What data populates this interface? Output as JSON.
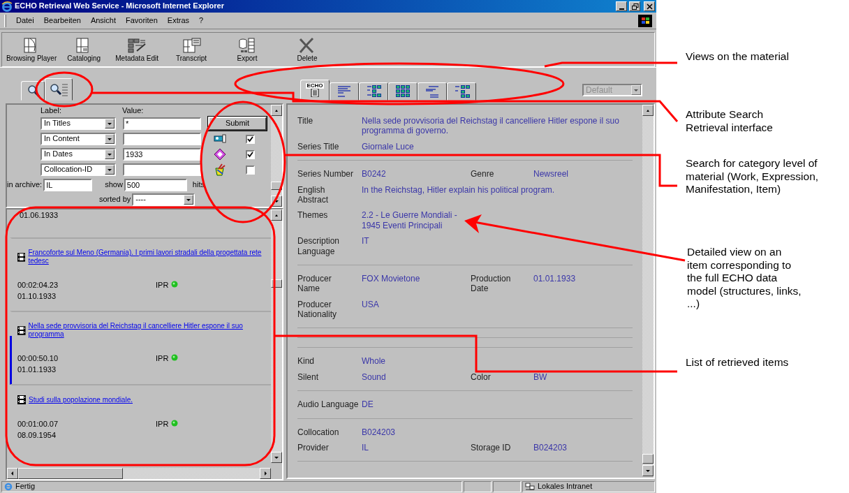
{
  "window": {
    "title": "ECHO Retrieval Web Service - Microsoft Internet Explorer"
  },
  "menu": [
    "Datei",
    "Bearbeiten",
    "Ansicht",
    "Favoriten",
    "Extras",
    "?"
  ],
  "toolbar": [
    "Browsing Player",
    "Cataloging",
    "Metadata Edit",
    "Transcript",
    "Export",
    "Delete"
  ],
  "search_tabs": [
    {
      "selected": false
    },
    {
      "selected": true
    }
  ],
  "view_tabs": [
    {
      "label": "ECHO",
      "selected": true
    },
    {
      "selected": false
    },
    {
      "selected": false
    },
    {
      "selected": false
    },
    {
      "selected": false
    },
    {
      "selected": false
    }
  ],
  "view_select": {
    "value": "Default",
    "disabled": true
  },
  "search_form": {
    "label_header": "Label:",
    "value_header": "Value:",
    "rows": [
      {
        "field": "In Titles",
        "value": "*"
      },
      {
        "field": "In Content"
      },
      {
        "field": "In Dates",
        "value": "1933"
      },
      {
        "field": "Collocation-ID"
      }
    ],
    "submit": "Submit",
    "categories": [
      {
        "checked": true
      },
      {
        "checked": true
      },
      {
        "checked": false
      }
    ],
    "archive_label": "in archive:",
    "archive": "IL",
    "show_label": "show",
    "show": "500",
    "hits_label": "hits",
    "sorted_label": "sorted by",
    "sorted": "----"
  },
  "results": {
    "partial_date": "01.06.1933",
    "items": [
      {
        "title": "Francoforte sul Meno (Germania). I primi lavori stradali della progettata rete tedesc",
        "duration": "00:02:04.23",
        "rights": "IPR",
        "date": "01.10.1933",
        "selected": false
      },
      {
        "title": "Nella sede provvisoria del Reichstag il cancelliere Hitler espone il suo programma",
        "duration": "00:00:50.10",
        "rights": "IPR",
        "date": "01.01.1933",
        "selected": true
      },
      {
        "title": "Studi sulla popolazione mondiale.",
        "duration": "00:01:00.07",
        "rights": "IPR",
        "date": "08.09.1954",
        "selected": false
      }
    ]
  },
  "detail": {
    "sections": [
      {
        "kind": "fields",
        "rows": [
          [
            {
              "label": "Title",
              "value": "Nella sede provvisoria del Reichstag il cancelliere Hitler espone il suo programma di governo."
            }
          ],
          [
            {
              "label": "Series Title",
              "value": "Giornale Luce"
            }
          ]
        ]
      },
      {
        "kind": "fields",
        "rows": [
          [
            {
              "label": "Series Number",
              "value": "B0242"
            },
            {
              "label": "Genre",
              "value": "Newsreel"
            }
          ],
          [
            {
              "label": "English\nAbstract",
              "value": "In the Reichstag, Hitler explain his political program."
            }
          ],
          [
            {
              "label": "Themes",
              "value": "2.2 - Le Guerre Mondiali -\n1945 Eventi Principali"
            }
          ],
          [
            {
              "label": "Description\nLanguage",
              "value": "IT"
            }
          ]
        ]
      },
      {
        "kind": "fields",
        "rows": [
          [
            {
              "label": "Producer\nName",
              "value": "FOX Movietone"
            },
            {
              "label": "Production\nDate",
              "value": "01.01.1933"
            }
          ],
          [
            {
              "label": "Producer\nNationality",
              "value": "USA"
            }
          ]
        ]
      },
      {
        "kind": "blank"
      },
      {
        "kind": "blank"
      },
      {
        "kind": "fields",
        "rows": [
          [
            {
              "label": "Kind",
              "value": "Whole"
            }
          ],
          [
            {
              "label": "Silent",
              "value": "Sound"
            },
            {
              "label": "Color",
              "value": "BW"
            }
          ]
        ]
      },
      {
        "kind": "fields",
        "rows": [
          [
            {
              "label": "Audio Language",
              "value": "DE"
            }
          ]
        ]
      },
      {
        "kind": "fields",
        "rows": [
          [
            {
              "label": "Collocation",
              "value": "B024203"
            }
          ],
          [
            {
              "label": "Provider",
              "value": "IL"
            },
            {
              "label": "Storage ID",
              "value": "B024203"
            }
          ]
        ]
      }
    ]
  },
  "status_bar": {
    "text": "Fertig",
    "zone": "Lokales Intranet"
  },
  "callouts": [
    "Views on the material",
    "Attribute Search Retrieval interface",
    "Search for category level of material (Work, Expression, Manifestation, Item)",
    "Detailed view on an item corresponding to the full ECHO data model (structures, links, ...)",
    "List of retrieved items"
  ]
}
